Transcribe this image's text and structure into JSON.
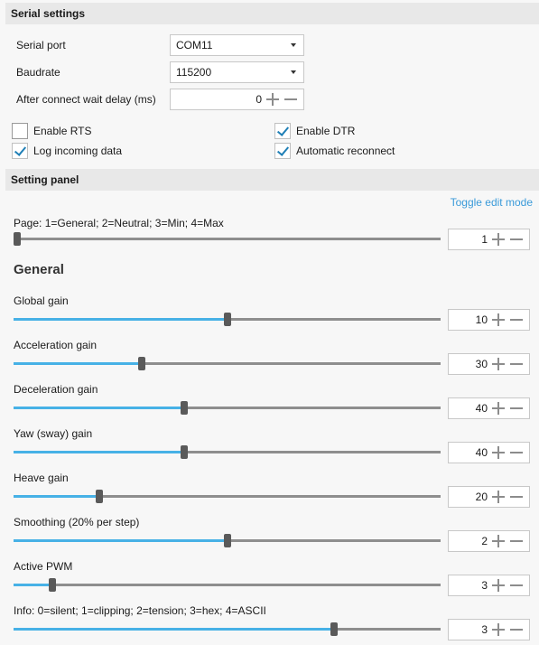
{
  "serial": {
    "title": "Serial settings",
    "port_label": "Serial port",
    "port_value": "COM11",
    "baud_label": "Baudrate",
    "baud_value": "115200",
    "delay_label": "After connect wait delay (ms)",
    "delay_value": "0",
    "checkboxes": [
      {
        "label": "Enable RTS",
        "checked": false
      },
      {
        "label": "Enable DTR",
        "checked": true
      },
      {
        "label": "Log incoming data",
        "checked": true
      },
      {
        "label": "Automatic reconnect",
        "checked": true
      }
    ]
  },
  "panel": {
    "title": "Setting panel",
    "toggle": "Toggle edit mode",
    "page_label": "Page: 1=General; 2=Neutral; 3=Min; 4=Max",
    "page_value": "1",
    "page_fraction": 0.0,
    "group": "General",
    "sliders": [
      {
        "label": "Global gain",
        "value": "10",
        "fraction": 0.5
      },
      {
        "label": "Acceleration gain",
        "value": "30",
        "fraction": 0.3
      },
      {
        "label": "Deceleration gain",
        "value": "40",
        "fraction": 0.4
      },
      {
        "label": "Yaw (sway) gain",
        "value": "40",
        "fraction": 0.4
      },
      {
        "label": "Heave gain",
        "value": "20",
        "fraction": 0.2
      },
      {
        "label": "Smoothing (20% per step)",
        "value": "2",
        "fraction": 0.5
      },
      {
        "label": "Active PWM",
        "value": "3",
        "fraction": 0.09
      },
      {
        "label": "Info: 0=silent; 1=clipping; 2=tension; 3=hex; 4=ASCII",
        "value": "3",
        "fraction": 0.75
      }
    ]
  },
  "colors": {
    "accent": "#47b1e6",
    "link": "#3a9ad9",
    "check": "#1f7fb6"
  }
}
